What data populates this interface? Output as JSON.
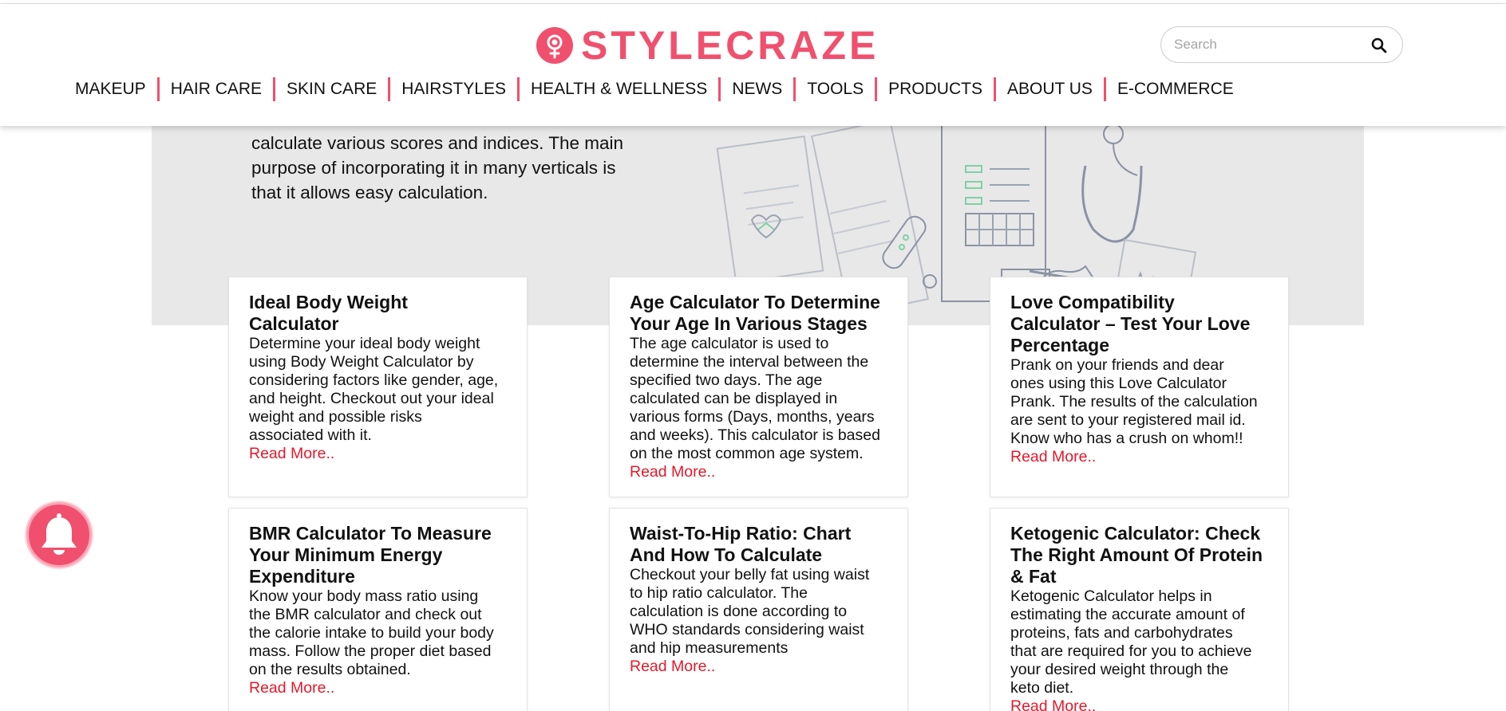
{
  "brand": {
    "name": "STYLECRAZE",
    "accent": "#f0506e"
  },
  "search": {
    "placeholder": "Search",
    "icon": "search-icon"
  },
  "nav": [
    "MAKEUP",
    "HAIR CARE",
    "SKIN CARE",
    "HAIRSTYLES",
    "HEALTH & WELLNESS",
    "NEWS",
    "TOOLS",
    "PRODUCTS",
    "ABOUT US",
    "E-COMMERCE"
  ],
  "hero": {
    "lines": [
      "calculate various scores and indices. The main",
      "purpose of incorporating it in many verticals is",
      "that it allows easy calculation."
    ]
  },
  "cards": [
    {
      "title_lines": [
        "Ideal Body Weight",
        "Calculator"
      ],
      "desc_lines": [
        "Determine your ideal body weight",
        "using Body Weight Calculator by",
        "considering factors like gender, age,",
        "and height. Checkout out your ideal",
        "weight and possible risks",
        "associated with it."
      ],
      "more": "Read More.."
    },
    {
      "title_lines": [
        "Age Calculator To Determine",
        "Your Age In Various Stages"
      ],
      "desc_lines": [
        "The age calculator is used to",
        "determine the interval between the",
        "specified two days. The age",
        "calculated can be displayed in",
        "various forms (Days, months, years",
        "and weeks). This calculator is based",
        "on the most common age system."
      ],
      "more": "Read More.."
    },
    {
      "title_lines": [
        "Love Compatibility",
        "Calculator – Test Your Love",
        "Percentage"
      ],
      "desc_lines": [
        "Prank on your friends and dear",
        "ones using this Love Calculator",
        "Prank. The results of the calculation",
        "are sent to your registered mail id.",
        "Know who has a crush on whom!!"
      ],
      "more": "Read More.."
    },
    {
      "title_lines": [
        "BMR Calculator To Measure",
        "Your Minimum Energy",
        "Expenditure"
      ],
      "desc_lines": [
        "Know your body mass ratio using",
        "the BMR calculator and check out",
        "the calorie intake to build your body",
        "mass. Follow the proper diet based",
        "on the results obtained."
      ],
      "more": "Read More.."
    },
    {
      "title_lines": [
        "Waist-To-Hip Ratio: Chart",
        "And How To Calculate"
      ],
      "desc_lines": [
        "Checkout your belly fat using waist",
        "to hip ratio calculator. The",
        "calculation is done according to",
        "WHO standards considering waist",
        "and hip measurements"
      ],
      "more": "Read More.."
    },
    {
      "title_lines": [
        "Ketogenic Calculator: Check",
        "The Right Amount Of Protein",
        "& Fat"
      ],
      "desc_lines": [
        "Ketogenic Calculator helps in",
        "estimating the accurate amount of",
        "proteins, fats and carbohydrates",
        "that are required for you to achieve",
        "your desired weight through the",
        "keto diet."
      ],
      "more": "Read More.."
    }
  ],
  "notification": {
    "icon": "bell-icon"
  }
}
